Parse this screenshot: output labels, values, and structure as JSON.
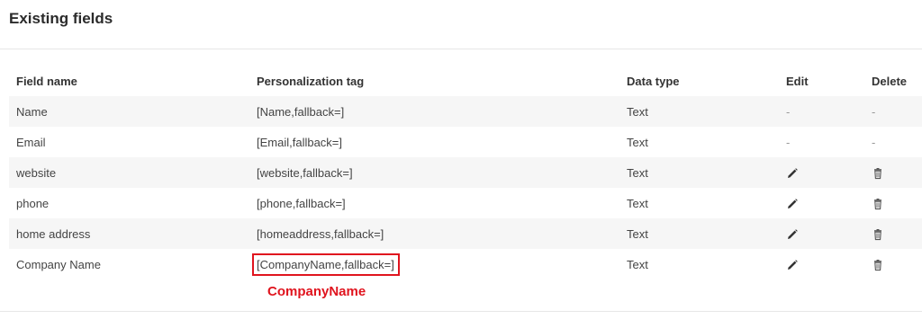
{
  "section": {
    "title": "Existing fields"
  },
  "table": {
    "headers": {
      "field_name": "Field name",
      "tag": "Personalization tag",
      "data_type": "Data type",
      "edit": "Edit",
      "delete": "Delete"
    },
    "rows": [
      {
        "name": "Name",
        "tag": "[Name,fallback=]",
        "type": "Text",
        "edit": "-",
        "delete": "-"
      },
      {
        "name": "Email",
        "tag": "[Email,fallback=]",
        "type": "Text",
        "edit": "-",
        "delete": "-"
      },
      {
        "name": "website",
        "tag": "[website,fallback=]",
        "type": "Text",
        "edit_icon": "pencil-icon",
        "delete_icon": "trash-icon"
      },
      {
        "name": "phone",
        "tag": "[phone,fallback=]",
        "type": "Text",
        "edit_icon": "pencil-icon",
        "delete_icon": "trash-icon"
      },
      {
        "name": "home address",
        "tag": "[homeaddress,fallback=]",
        "type": "Text",
        "edit_icon": "pencil-icon",
        "delete_icon": "trash-icon"
      },
      {
        "name": "Company Name",
        "tag": "[CompanyName,fallback=]",
        "type": "Text",
        "edit_icon": "pencil-icon",
        "delete_icon": "trash-icon"
      }
    ]
  },
  "annotation": {
    "text": "CompanyName",
    "color": "#e0141e"
  }
}
